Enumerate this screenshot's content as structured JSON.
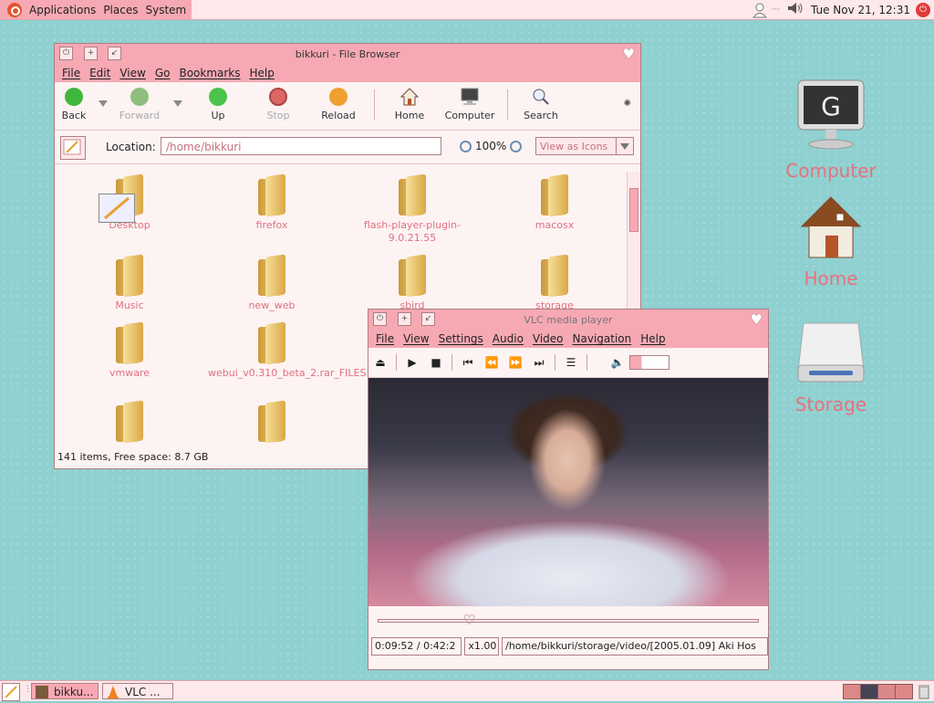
{
  "top_panel": {
    "menus": [
      "Applications",
      "Places",
      "System"
    ],
    "clock": "Tue Nov 21, 12:31",
    "ellipsis": "···"
  },
  "desktop": {
    "icons": [
      {
        "label": "Computer",
        "icon": "computer-monitor-icon"
      },
      {
        "label": "Home",
        "icon": "house-icon"
      },
      {
        "label": "Storage",
        "icon": "drive-icon"
      }
    ]
  },
  "file_browser": {
    "title": "bikkuri - File Browser",
    "menu": [
      "File",
      "Edit",
      "View",
      "Go",
      "Bookmarks",
      "Help"
    ],
    "toolbar": {
      "back": "Back",
      "forward": "Forward",
      "up": "Up",
      "stop": "Stop",
      "reload": "Reload",
      "home": "Home",
      "computer": "Computer",
      "search": "Search"
    },
    "location_label": "Location:",
    "location_value": "/home/bikkuri",
    "zoom": "100%",
    "view_as": "View as Icons",
    "items": [
      "Desktop",
      "firefox",
      "flash-player-plugin-9.0.21.55",
      "macosx",
      "Music",
      "new_web",
      "sbird",
      "storage",
      "vmware",
      "webui_v0.310_beta_2.rar_FILES",
      "",
      ""
    ],
    "status": "141 items, Free space: 8.7 GB"
  },
  "vlc": {
    "title": "VLC media player",
    "menu": [
      "File",
      "View",
      "Settings",
      "Audio",
      "Video",
      "Navigation",
      "Help"
    ],
    "seek_fraction": 0.24,
    "time": "0:09:52 / 0:42:2",
    "speed": "x1.00",
    "file_path": "/home/bikkuri/storage/video/[2005.01.09] Aki Hos"
  },
  "taskbar": {
    "tasks": [
      "bikku...",
      "VLC ..."
    ]
  },
  "colors": {
    "accent_pink": "#f6a9b3",
    "desktop_teal": "#8fd0d0",
    "label_pink": "#e9707d"
  }
}
